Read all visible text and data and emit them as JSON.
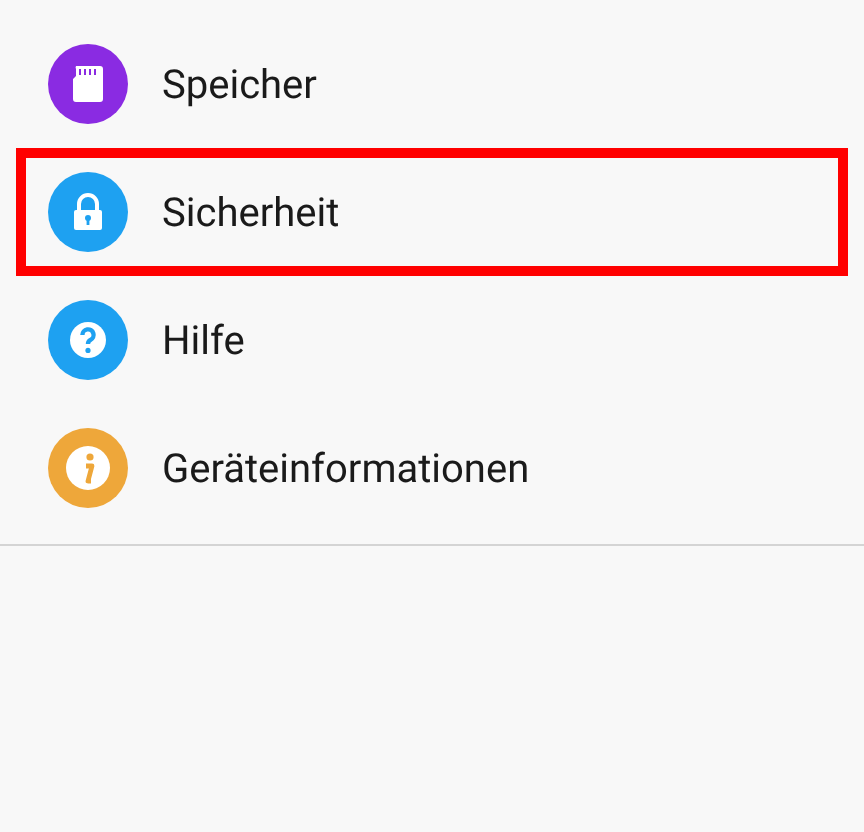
{
  "items": [
    {
      "label": "Speicher",
      "kind": "sd-card",
      "color": "#8a2be2",
      "highlighted": false
    },
    {
      "label": "Sicherheit",
      "kind": "lock",
      "color": "#1ea1f1",
      "highlighted": true
    },
    {
      "label": "Hilfe",
      "kind": "help",
      "color": "#1ea1f1",
      "highlighted": false
    },
    {
      "label": "Geräteinformationen",
      "kind": "info",
      "color": "#eea73a",
      "highlighted": false
    }
  ]
}
